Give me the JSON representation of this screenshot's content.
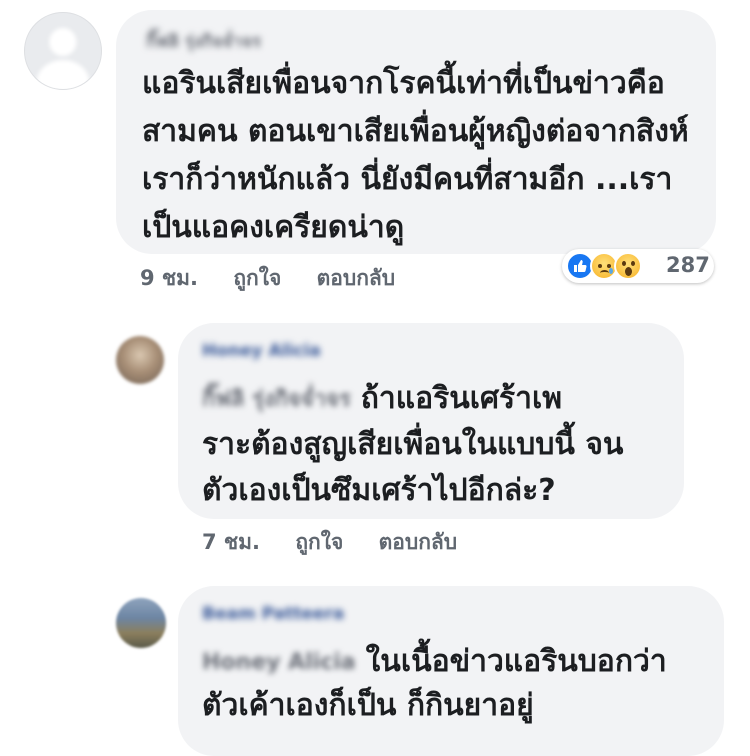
{
  "comments": [
    {
      "author": "กิ๊ฟลิ รุ่งกิจจ่ำจร",
      "lines": [
        "แอรินเสียเพื่อนจากโรคนี้เท่าที่เป็นข่าวคือ",
        "สามคน ตอนเขาเสียเพื่อนผู้หญิงต่อจากสิงห์",
        "เราก็ว่าหนักแล้ว นี่ยังมีคนที่สามอีก ...เรา",
        "เป็นแอคงเครียดน่าดู"
      ],
      "time": "9 ชม.",
      "like": "ถูกใจ",
      "reply": "ตอบกลับ",
      "reaction_count": "287",
      "reaction_icons": [
        "like-icon",
        "sad-icon",
        "wow-icon"
      ]
    },
    {
      "author": "Honey Alicia",
      "mention": "กิ๊ฟลิ รุ่งกิจจ่ำจร",
      "lines": [
        "ถ้าแอรินเศร้าเพ",
        "ราะต้องสูญเสียเพื่อนในแบบนี้ จน",
        "ตัวเองเป็นซึมเศร้าไปอีกล่ะ?"
      ],
      "time": "7 ชม.",
      "like": "ถูกใจ",
      "reply": "ตอบกลับ"
    },
    {
      "author": "Beam Patteera",
      "mention": "Honey Alicia",
      "lines": [
        "ในเนื้อข่าวแอรินบอกว่า",
        "ตัวเค้าเองก็เป็น ก็กินยาอยู่"
      ]
    }
  ],
  "colors": {
    "bubble": "#f2f3f5",
    "name": "#385898",
    "meta": "#606770",
    "like": "#1877f2"
  }
}
